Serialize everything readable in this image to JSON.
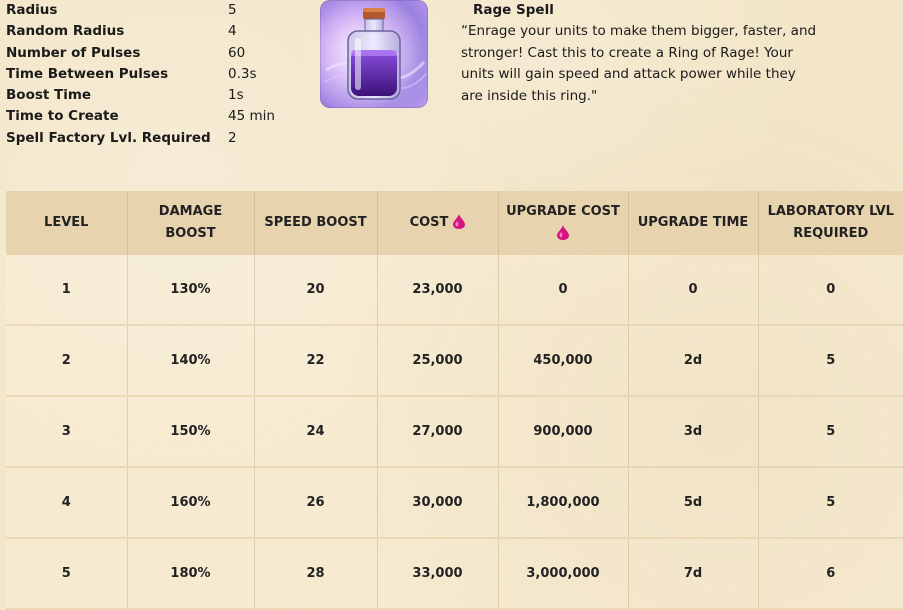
{
  "stats": [
    {
      "label": "Radius",
      "value": "5"
    },
    {
      "label": "Random Radius",
      "value": "4"
    },
    {
      "label": "Number of Pulses",
      "value": "60"
    },
    {
      "label": "Time Between Pulses",
      "value": "0.3s"
    },
    {
      "label": "Boost Time",
      "value": "1s"
    },
    {
      "label": "Time to Create",
      "value": "45 min"
    },
    {
      "label": "Spell Factory Lvl. Required",
      "value": "2"
    }
  ],
  "spell": {
    "icon": "rage-spell-bottle",
    "title": "Rage Spell",
    "description": "“Enrage your units to make them bigger, faster, and stronger! Cast this to create a Ring of Rage! Your units will gain speed and attack power while they are inside this ring.\""
  },
  "table": {
    "headers": {
      "level": "LEVEL",
      "damage": "DAMAGE BOOST",
      "speed": "SPEED BOOST",
      "cost": "COST",
      "upgrade_cost": "UPGRADE COST",
      "upgrade_time": "UPGRADE TIME",
      "lab": "LABORATORY LVL REQUIRED"
    },
    "currency_icon": "elixir-drop",
    "rows": [
      {
        "level": "1",
        "damage": "130%",
        "speed": "20",
        "cost": "23,000",
        "upgrade_cost": "0",
        "upgrade_time": "0",
        "lab": "0"
      },
      {
        "level": "2",
        "damage": "140%",
        "speed": "22",
        "cost": "25,000",
        "upgrade_cost": "450,000",
        "upgrade_time": "2d",
        "lab": "5"
      },
      {
        "level": "3",
        "damage": "150%",
        "speed": "24",
        "cost": "27,000",
        "upgrade_cost": "900,000",
        "upgrade_time": "3d",
        "lab": "5"
      },
      {
        "level": "4",
        "damage": "160%",
        "speed": "26",
        "cost": "30,000",
        "upgrade_cost": "1,800,000",
        "upgrade_time": "5d",
        "lab": "5"
      },
      {
        "level": "5",
        "damage": "180%",
        "speed": "28",
        "cost": "33,000",
        "upgrade_cost": "3,000,000",
        "upgrade_time": "7d",
        "lab": "6"
      }
    ]
  },
  "colors": {
    "background": "#f3e6c8",
    "header_bg": "#e7d3ad",
    "elixir": "#d6137e",
    "potion": "#6a2ab5"
  }
}
